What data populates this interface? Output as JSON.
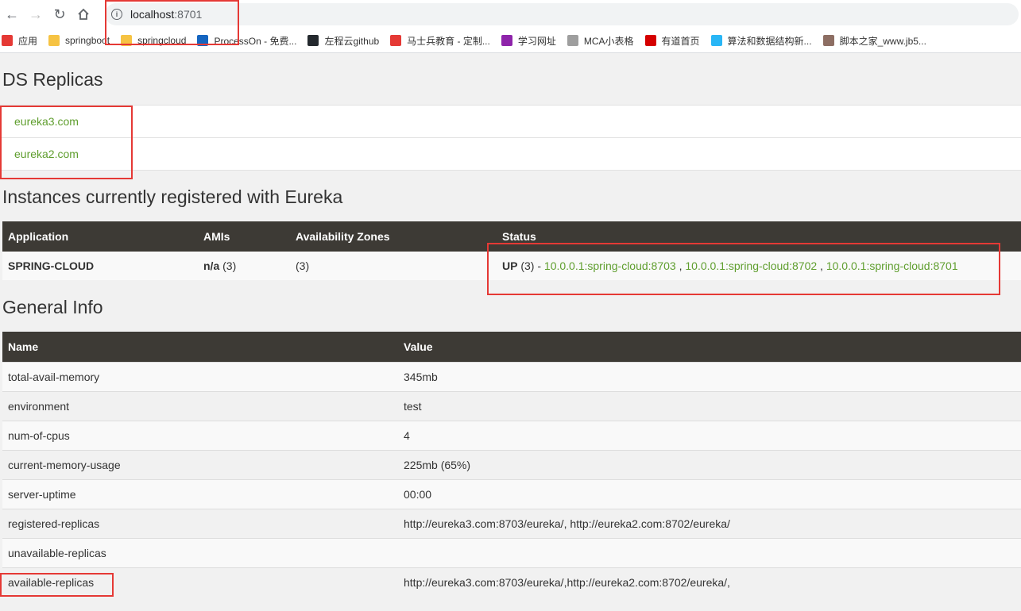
{
  "browser": {
    "url_host": "localhost",
    "url_port": ":8701",
    "bookmarks": [
      {
        "label": "应用",
        "icon": "apps-grid-icon",
        "color": "#e53935"
      },
      {
        "label": "springboot",
        "icon": "folder-icon",
        "color": "#f6c343"
      },
      {
        "label": "springcloud",
        "icon": "folder-icon",
        "color": "#f6c343"
      },
      {
        "label": "ProcessOn - 免费...",
        "icon": "processon-icon",
        "color": "#1565c0"
      },
      {
        "label": "左程云github",
        "icon": "github-icon",
        "color": "#24292e"
      },
      {
        "label": "马士兵教育 - 定制...",
        "icon": "mashibing-icon",
        "color": "#e53935"
      },
      {
        "label": "学习网址",
        "icon": "bookmark-icon",
        "color": "#8e24aa"
      },
      {
        "label": "MCA小表格",
        "icon": "sheet-icon",
        "color": "#9e9e9e"
      },
      {
        "label": "有道首页",
        "icon": "youdao-icon",
        "color": "#d50000"
      },
      {
        "label": "算法和数据结构新...",
        "icon": "diamond-icon",
        "color": "#29b6f6"
      },
      {
        "label": "脚本之家_www.jb5...",
        "icon": "jb51-icon",
        "color": "#8d6e63"
      }
    ]
  },
  "ds_replicas": {
    "title": "DS Replicas",
    "items": [
      "eureka3.com",
      "eureka2.com"
    ]
  },
  "instances": {
    "title": "Instances currently registered with Eureka",
    "headers": [
      "Application",
      "AMIs",
      "Availability Zones",
      "Status"
    ],
    "rows": [
      {
        "application": "SPRING-CLOUD",
        "amis_bold": "n/a",
        "amis_count": " (3)",
        "zones": "(3)",
        "status_bold": "UP",
        "status_count": " (3) - ",
        "links": [
          "10.0.0.1:spring-cloud:8703",
          "10.0.0.1:spring-cloud:8702",
          "10.0.0.1:spring-cloud:8701"
        ],
        "link_separator": " , "
      }
    ]
  },
  "general_info": {
    "title": "General Info",
    "headers": [
      "Name",
      "Value"
    ],
    "rows": [
      {
        "name": "total-avail-memory",
        "value": "345mb"
      },
      {
        "name": "environment",
        "value": "test"
      },
      {
        "name": "num-of-cpus",
        "value": "4"
      },
      {
        "name": "current-memory-usage",
        "value": "225mb (65%)"
      },
      {
        "name": "server-uptime",
        "value": "00:00"
      },
      {
        "name": "registered-replicas",
        "value": "http://eureka3.com:8703/eureka/, http://eureka2.com:8702/eureka/"
      },
      {
        "name": "unavailable-replicas",
        "value": ""
      },
      {
        "name": "available-replicas",
        "value": "http://eureka3.com:8703/eureka/,http://eureka2.com:8702/eureka/,"
      }
    ]
  },
  "highlight_color": "#e53935"
}
